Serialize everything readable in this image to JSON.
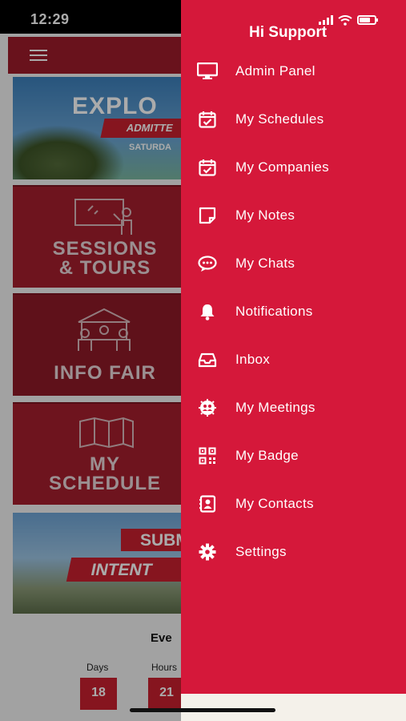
{
  "status_bar": {
    "time": "12:29"
  },
  "background_app": {
    "banner": {
      "title": "EXPLO",
      "strip": "ADMITTE",
      "subtitle": "SATURDA"
    },
    "tiles": {
      "sessions": {
        "line1": "SESSIONS",
        "line2": "& TOURS"
      },
      "info_fair": {
        "line1": "INFO FAIR"
      },
      "schedule": {
        "line1": "MY",
        "line2": "SCHEDULE"
      },
      "intent": {
        "line1": "SUBM",
        "line2": "INTENT"
      }
    },
    "countdown": {
      "event_label": "Eve",
      "days_label": "Days",
      "days_value": "18",
      "hours_label": "Hours",
      "hours_value": "21"
    }
  },
  "drawer": {
    "greeting": "Hi Support",
    "items": [
      {
        "label": "Admin Panel",
        "icon": "monitor-icon"
      },
      {
        "label": "My Schedules",
        "icon": "calendar-check-icon"
      },
      {
        "label": "My Companies",
        "icon": "calendar-check-icon"
      },
      {
        "label": "My Notes",
        "icon": "note-icon"
      },
      {
        "label": "My Chats",
        "icon": "chat-bubble-icon"
      },
      {
        "label": "Notifications",
        "icon": "bell-icon"
      },
      {
        "label": "Inbox",
        "icon": "inbox-tray-icon"
      },
      {
        "label": "My Meetings",
        "icon": "meeting-icon"
      },
      {
        "label": "My Badge",
        "icon": "qr-code-icon"
      },
      {
        "label": "My Contacts",
        "icon": "contact-card-icon"
      },
      {
        "label": "Settings",
        "icon": "gear-icon"
      }
    ]
  },
  "colors": {
    "drawer_bg": "#d5183a",
    "app_red": "#a51f2e",
    "text": "#ffffff"
  }
}
